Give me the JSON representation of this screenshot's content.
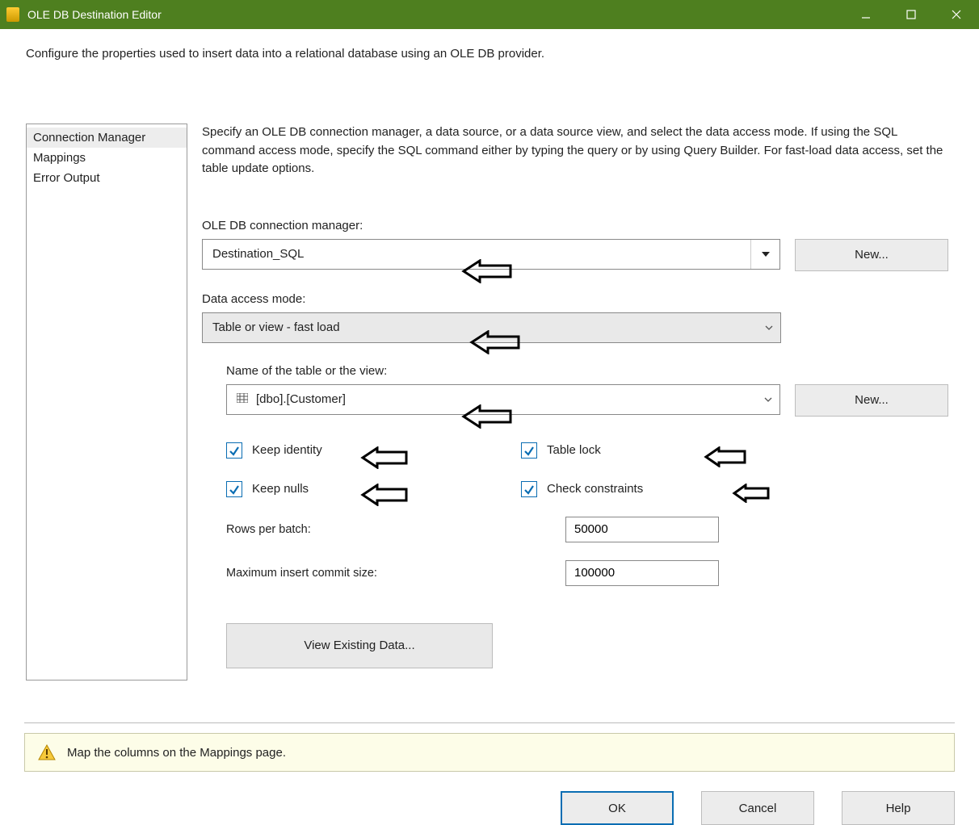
{
  "window": {
    "title": "OLE DB Destination Editor"
  },
  "header": {
    "description": "Configure the properties used to insert data into a relational database using an OLE DB provider."
  },
  "sidebar": {
    "items": [
      {
        "label": "Connection Manager",
        "selected": true
      },
      {
        "label": "Mappings",
        "selected": false
      },
      {
        "label": "Error Output",
        "selected": false
      }
    ]
  },
  "main": {
    "instruction": "Specify an OLE DB connection manager, a data source, or a data source view, and select the data access mode. If using the SQL command access mode, specify the SQL command either by typing the query or by using Query Builder. For fast-load data access, set the table update options.",
    "conn_label": "OLE DB connection manager:",
    "conn_value": "Destination_SQL",
    "new_button": "New...",
    "mode_label": "Data access mode:",
    "mode_value": "Table or view - fast load",
    "table_label": "Name of the table or the view:",
    "table_value": "[dbo].[Customer]",
    "checks": {
      "keep_identity": "Keep identity",
      "table_lock": "Table lock",
      "keep_nulls": "Keep nulls",
      "check_constraints": "Check constraints"
    },
    "rows_per_batch_label": "Rows per batch:",
    "rows_per_batch_value": "50000",
    "max_commit_label": "Maximum insert commit size:",
    "max_commit_value": "100000",
    "view_existing": "View Existing Data..."
  },
  "warning": {
    "text": "Map the columns on the Mappings page."
  },
  "footer": {
    "ok": "OK",
    "cancel": "Cancel",
    "help": "Help"
  }
}
